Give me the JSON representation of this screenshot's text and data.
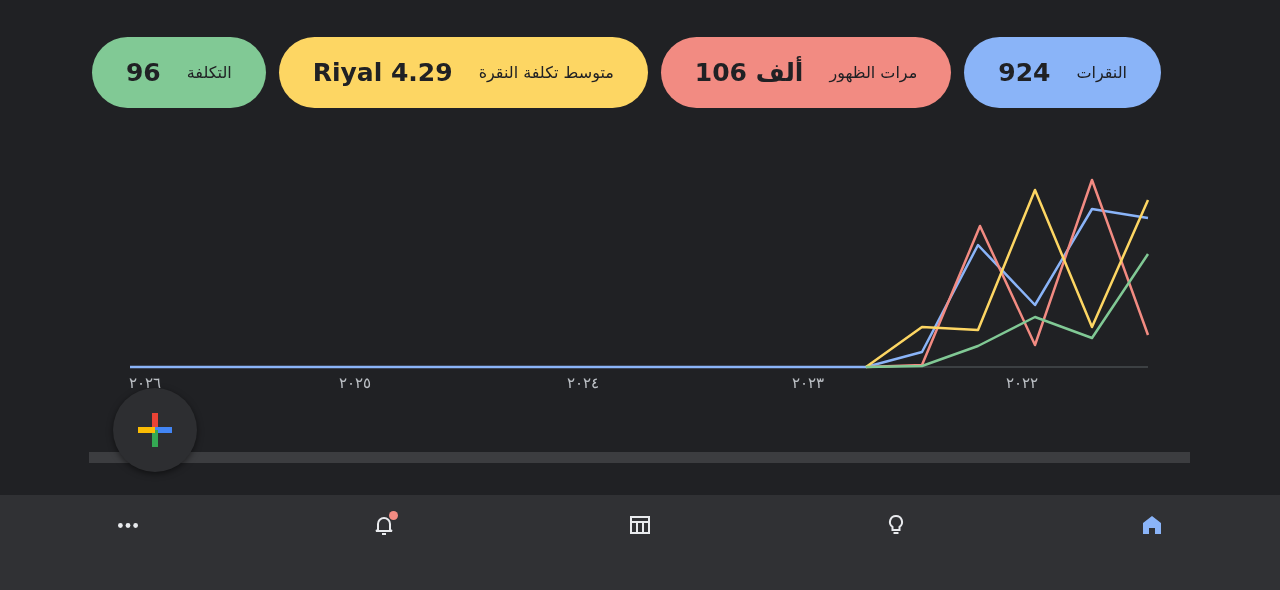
{
  "metrics": [
    {
      "label": "النقرات",
      "value": "924",
      "color": "#8ab4f8"
    },
    {
      "label": "مرات الظهور",
      "value": "106 ألف",
      "color": "#f28b82"
    },
    {
      "label": "متوسط تكلفة النقرة",
      "value": "Riyal 4.29",
      "color": "#fdd663"
    },
    {
      "label": "التكلفة",
      "value": "96",
      "color": "#81c995"
    }
  ],
  "chart": {
    "x_labels": [
      "٢٠٢٢",
      "٢٠٢٣",
      "٢٠٢٤",
      "٢٠٢٥",
      "٢٠٢٦"
    ]
  },
  "nav": [
    {
      "kind": "home",
      "selected": true,
      "badge": false
    },
    {
      "kind": "lightbulb",
      "selected": false,
      "badge": false
    },
    {
      "kind": "table",
      "selected": false,
      "badge": false
    },
    {
      "kind": "bell",
      "selected": false,
      "badge": true
    },
    {
      "kind": "more",
      "selected": false,
      "badge": false
    }
  ]
}
